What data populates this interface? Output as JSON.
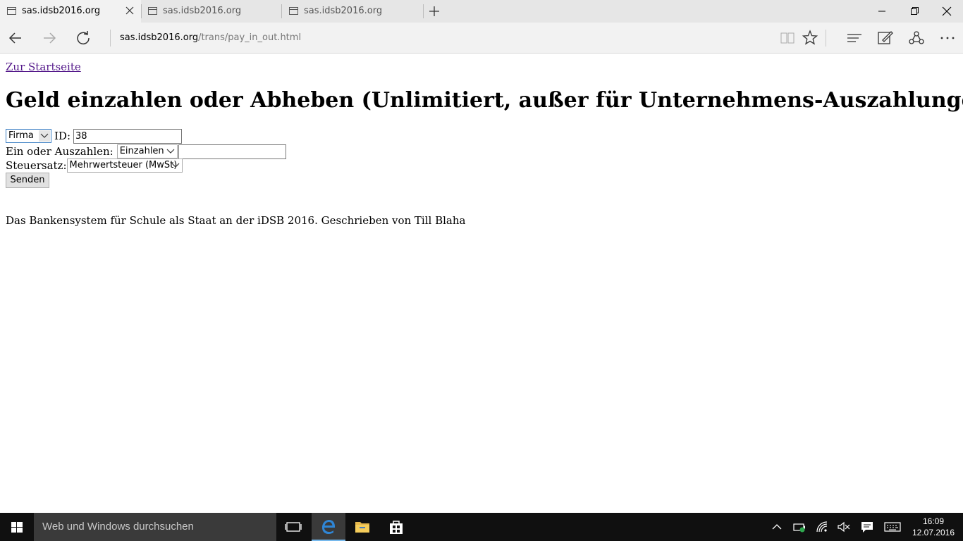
{
  "browser": {
    "tabs": [
      {
        "label": "sas.idsb2016.org",
        "active": true
      },
      {
        "label": "sas.idsb2016.org",
        "active": false
      },
      {
        "label": "sas.idsb2016.org",
        "active": false
      }
    ],
    "address": {
      "host": "sas.idsb2016.org",
      "path": "/trans/pay_in_out.html"
    },
    "icons": [
      "back-icon",
      "forward-icon",
      "refresh-icon",
      "reading-view-icon",
      "favorite-star-icon",
      "hub-icon",
      "web-note-icon",
      "share-icon",
      "more-icon"
    ]
  },
  "page": {
    "home_link": "Zur Startseite",
    "title": "Geld einzahlen oder Abheben (Unlimitiert, außer für Unternehmens-Auszahlungen)",
    "form": {
      "type_select_value": "Firma",
      "id_label": "ID:",
      "id_value": "38",
      "inout_label": "Ein oder Auszahlen:",
      "inout_select_value": "Einzahlen",
      "amount_value": "",
      "tax_label": "Steuersatz:",
      "tax_select_value": "Mehrwertsteuer (MwSt)",
      "submit_label": "Senden"
    },
    "footer": "Das Bankensystem für Schule als Staat an der iDSB 2016. Geschrieben von Till Blaha"
  },
  "taskbar": {
    "search_placeholder": "Web und Windows durchsuchen",
    "time": "16:09",
    "date": "12.07.2016",
    "accent_color": "#76b9ed"
  }
}
